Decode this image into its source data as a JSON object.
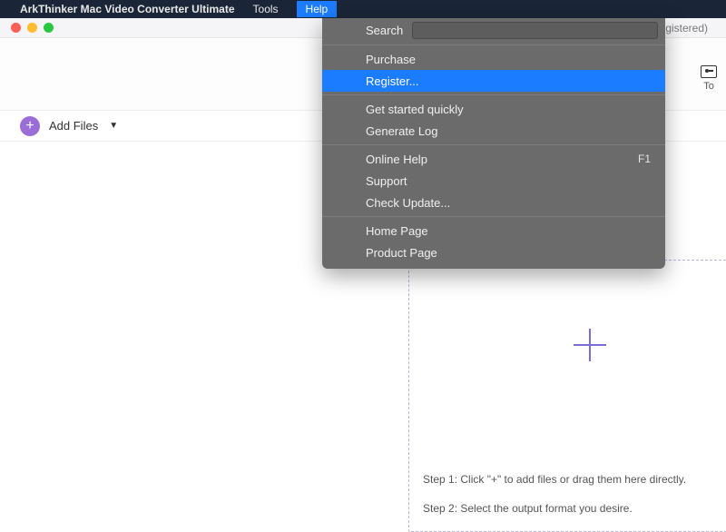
{
  "menubar": {
    "app_name": "ArkThinker Mac Video Converter Ultimate",
    "items": [
      "Tools",
      "Help"
    ],
    "active_index": 1
  },
  "window": {
    "right_text": "gistered)"
  },
  "top_right": {
    "label": "To"
  },
  "addfiles": {
    "label": "Add Files"
  },
  "help_menu": {
    "search_label": "Search",
    "groups": [
      [
        "Purchase",
        "Register..."
      ],
      [
        "Get started quickly",
        "Generate Log"
      ],
      [
        "Online Help",
        "Support",
        "Check Update..."
      ],
      [
        "Home Page",
        "Product Page"
      ]
    ],
    "highlighted": "Register...",
    "shortcuts": {
      "Online Help": "F1"
    }
  },
  "dropzone": {
    "step1": "Step 1: Click \"+\" to add files or drag them here directly.",
    "step2": "Step 2: Select the output format you desire."
  }
}
